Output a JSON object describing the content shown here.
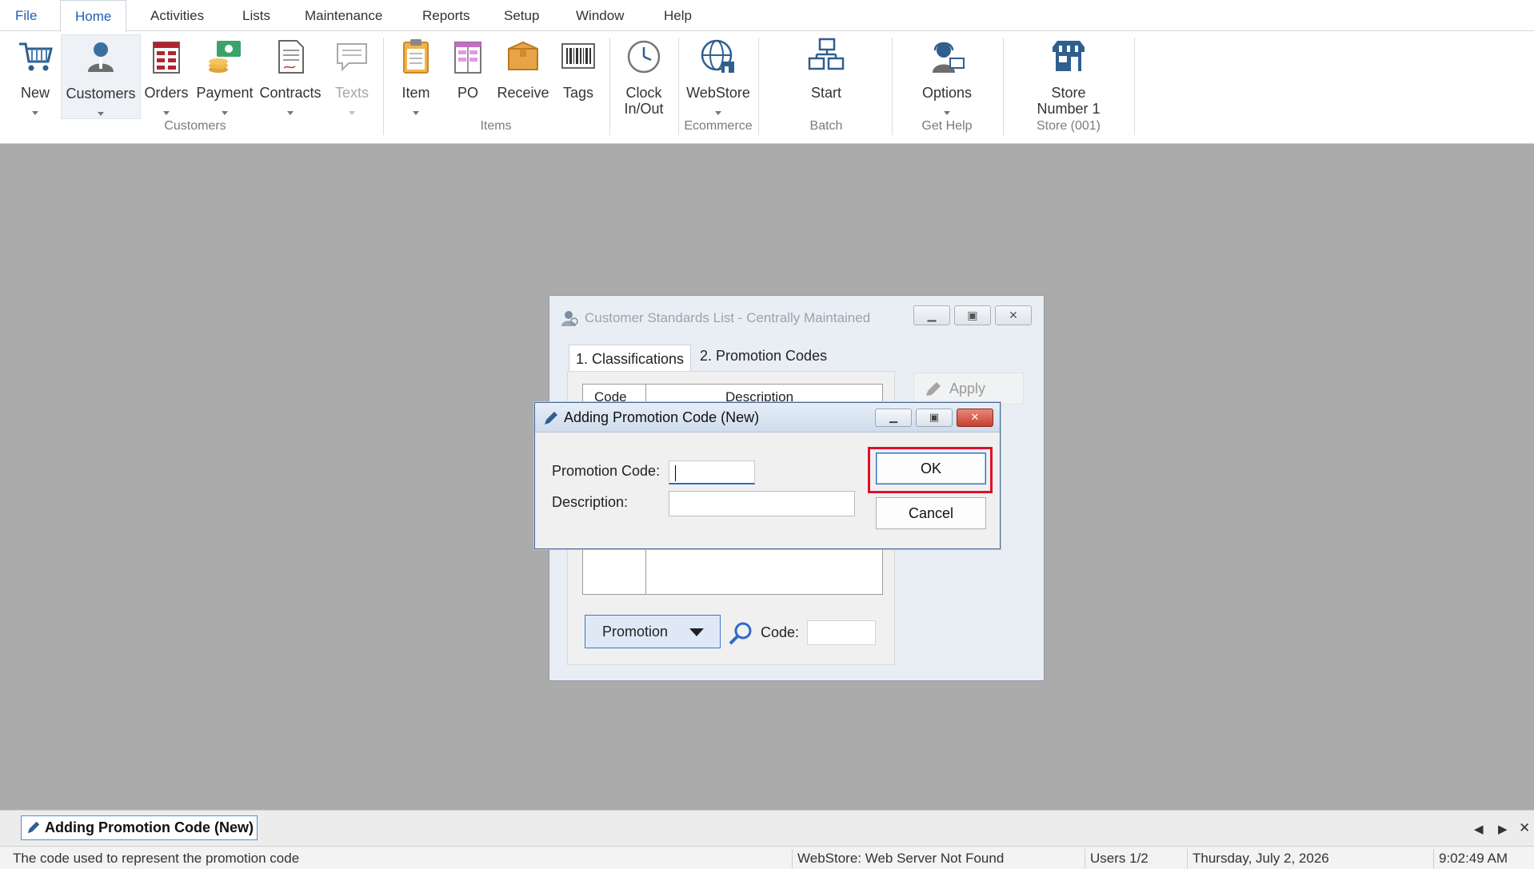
{
  "menu": {
    "items": [
      "File",
      "Home",
      "Activities",
      "Lists",
      "Maintenance",
      "Reports",
      "Setup",
      "Window",
      "Help"
    ],
    "active": "Home"
  },
  "ribbon": {
    "buttons": {
      "new": "New",
      "customers": "Customers",
      "orders": "Orders",
      "payment": "Payment",
      "contracts": "Contracts",
      "texts": "Texts",
      "item": "Item",
      "po": "PO",
      "receive": "Receive",
      "tags": "Tags",
      "clock": "Clock In/Out",
      "webstore": "WebStore",
      "start": "Start",
      "options": "Options",
      "store": "Store Number 1"
    },
    "groups": {
      "customers": "Customers",
      "items": "Items",
      "ecommerce": "Ecommerce",
      "batch": "Batch",
      "help": "Get Help",
      "store": "Store (001)"
    }
  },
  "outer_window": {
    "title": "Customer Standards List - Centrally Maintained",
    "tabs": [
      "1. Classifications",
      "2. Promotion Codes"
    ],
    "active_tab": "2. Promotion Codes",
    "grid_headers": [
      "Code",
      "Description"
    ],
    "apply_label": "Apply",
    "select_value": "Promotion",
    "code_label": "Code:",
    "code_value": ""
  },
  "dialog": {
    "title": "Adding Promotion Code  (New)",
    "promotion_code_label": "Promotion Code:",
    "promotion_code_value": "",
    "description_label": "Description:",
    "description_value": "",
    "ok_label": "OK",
    "cancel_label": "Cancel"
  },
  "taskbar": {
    "open_window": "Adding Promotion Code  (New)"
  },
  "status": {
    "hint": "The code used to represent the promotion code",
    "webstore": "WebStore: Web Server Not Found",
    "users": "Users 1/2",
    "date": "Thursday, July  2, 2026",
    "time": "9:02:49 AM"
  },
  "colors": {
    "accent": "#1e5fb4",
    "highlight": "#e0102a",
    "workspace": "#ababab"
  }
}
